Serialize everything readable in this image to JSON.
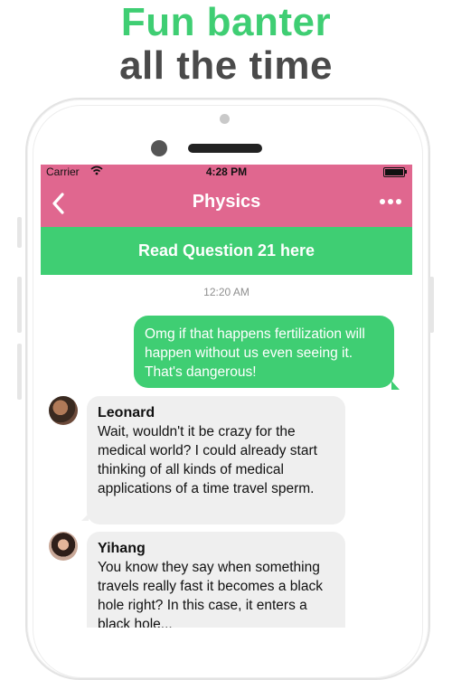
{
  "headline": {
    "line1": "Fun banter",
    "line2": "all the time",
    "line1_color": "#3fce73",
    "line2_color": "#4a4a4a"
  },
  "status_bar": {
    "carrier": "Carrier",
    "time": "4:28 PM"
  },
  "nav": {
    "title": "Physics",
    "back_icon": "chevron-left-icon",
    "more_icon": "more-dots-icon"
  },
  "question_banner": "Read Question 21 here",
  "timestamp": "12:20 AM",
  "messages": [
    {
      "direction": "outgoing",
      "text": "Omg if that happens fertilization will happen without us even seeing it. That's dangerous!"
    },
    {
      "direction": "incoming",
      "sender": "Leonard",
      "text": "Wait, wouldn't it be crazy for the medical world? I could already start thinking of all kinds of medical applications of a time travel sperm."
    },
    {
      "direction": "incoming",
      "sender": "Yihang",
      "text": "You know they say when something travels really fast it becomes a black hole right? In this case, it enters a black hole..."
    }
  ],
  "colors": {
    "nav_pink": "#e0678f",
    "accent_green": "#3fce73",
    "incoming_bubble": "#efefef"
  }
}
